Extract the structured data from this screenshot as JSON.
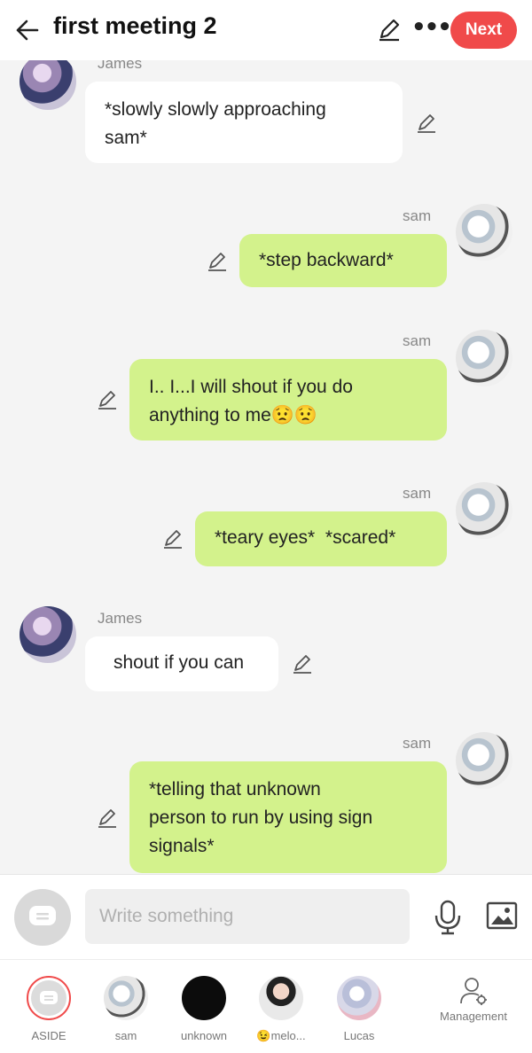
{
  "header": {
    "title": "first meeting 2",
    "next_label": "Next"
  },
  "messages": [
    {
      "sender": "James",
      "side": "left",
      "text_lines": [
        "*slowly slowly approaching",
        "sam*"
      ]
    },
    {
      "sender": "sam",
      "side": "right",
      "text_lines": [
        "*step backward*"
      ]
    },
    {
      "sender": "sam",
      "side": "right",
      "text_lines": [
        "I.. I...I will shout if you do",
        "anything to me😟😟"
      ]
    },
    {
      "sender": "sam",
      "side": "right",
      "text_lines": [
        "*teary eyes*  *scared*"
      ]
    },
    {
      "sender": "James",
      "side": "left",
      "text_lines": [
        "shout if you can"
      ]
    },
    {
      "sender": "sam",
      "side": "right",
      "text_lines": [
        "*telling that unknown",
        "person to run by using sign",
        "signals*"
      ]
    }
  ],
  "input": {
    "placeholder": "Write something"
  },
  "bottom_bar": [
    {
      "label": "ASIDE"
    },
    {
      "label": "sam"
    },
    {
      "label": "unknown"
    },
    {
      "label": "😉melo..."
    },
    {
      "label": "Lucas"
    },
    {
      "label": "Management"
    }
  ],
  "colors": {
    "accent": "#f04a4a",
    "green_bubble": "#d3f28c",
    "white_bubble": "#ffffff",
    "background": "#f4f4f4"
  }
}
